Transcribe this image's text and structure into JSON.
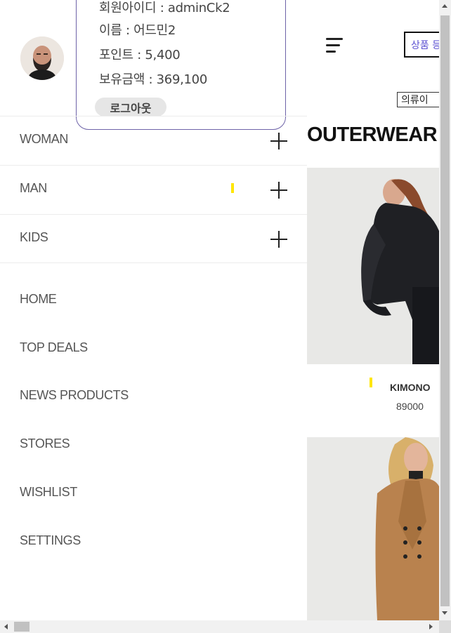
{
  "profile": {
    "id_line": "회원아이디 : adminCk2",
    "name_line": "이름 : 어드민2",
    "points_line": "포인트 : 5,400",
    "balance_line": "보유금액 : 369,100",
    "logout_label": "로그아웃"
  },
  "categories": [
    {
      "label": "WOMAN"
    },
    {
      "label": "MAN"
    },
    {
      "label": "KIDS"
    }
  ],
  "menu": [
    {
      "label": "HOME"
    },
    {
      "label": "TOP DEALS"
    },
    {
      "label": "NEWS PRODUCTS"
    },
    {
      "label": "STORES"
    },
    {
      "label": "WISHLIST"
    },
    {
      "label": "SETTINGS"
    }
  ],
  "main": {
    "category_button": "상품 등록",
    "sub_button": "의류이",
    "heading": "OUTERWEAR",
    "products": [
      {
        "name": "KIMONO",
        "price": "89000"
      }
    ]
  },
  "colors": {
    "accent_purple": "#5a4fd1",
    "card_border": "#6e63a8",
    "highlight_yellow": "#ffe600"
  }
}
